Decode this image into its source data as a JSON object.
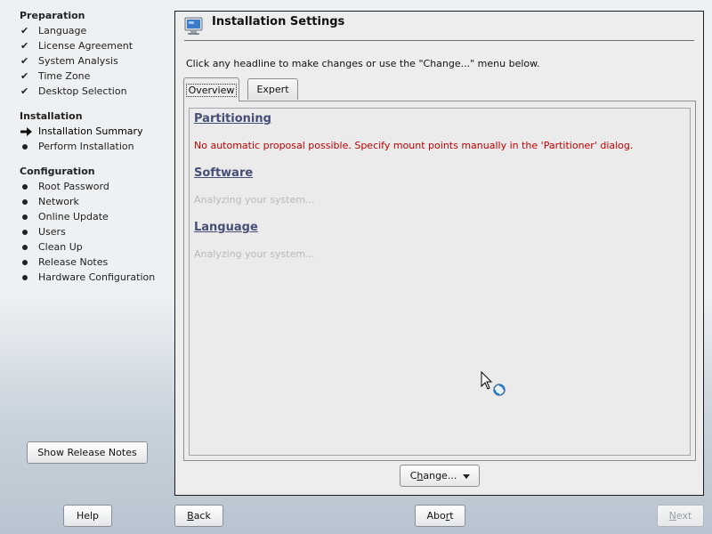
{
  "sidebar": {
    "groups": [
      {
        "heading": "Preparation",
        "items": [
          {
            "label": "Language",
            "state": "done"
          },
          {
            "label": "License Agreement",
            "state": "done"
          },
          {
            "label": "System Analysis",
            "state": "done"
          },
          {
            "label": "Time Zone",
            "state": "done"
          },
          {
            "label": "Desktop Selection",
            "state": "done"
          }
        ]
      },
      {
        "heading": "Installation",
        "items": [
          {
            "label": "Installation Summary",
            "state": "current"
          },
          {
            "label": "Perform Installation",
            "state": "todo"
          }
        ]
      },
      {
        "heading": "Configuration",
        "items": [
          {
            "label": "Root Password",
            "state": "todo"
          },
          {
            "label": "Network",
            "state": "todo"
          },
          {
            "label": "Online Update",
            "state": "todo"
          },
          {
            "label": "Users",
            "state": "todo"
          },
          {
            "label": "Clean Up",
            "state": "todo"
          },
          {
            "label": "Release Notes",
            "state": "todo"
          },
          {
            "label": "Hardware Configuration",
            "state": "todo"
          }
        ]
      }
    ],
    "release_notes_button": "Show Release Notes"
  },
  "main": {
    "title": "Installation Settings",
    "title_icon": "monitor-settings-icon",
    "instruction": "Click any headline to make changes or use the \"Change...\" menu below.",
    "tabs": [
      {
        "label": "Overview",
        "active": true
      },
      {
        "label": "Expert",
        "active": false
      }
    ],
    "sections": [
      {
        "heading": "Partitioning",
        "text": "No automatic proposal possible. Specify mount points manually in the 'Partitioner' dialog.",
        "kind": "error"
      },
      {
        "heading": "Software",
        "text": "Analyzing your system...",
        "kind": "muted"
      },
      {
        "heading": "Language",
        "text": "Analyzing your system...",
        "kind": "muted"
      }
    ],
    "change_button": {
      "pre": "C",
      "underline": "h",
      "post": "ange..."
    }
  },
  "footer": {
    "help": "Help",
    "back": {
      "underline": "B",
      "post": "ack"
    },
    "abort": {
      "pre": "Abo",
      "underline": "r",
      "post": "t"
    },
    "next": {
      "underline": "N",
      "post": "ext"
    }
  },
  "colors": {
    "link": "#474f77",
    "error": "#c00000",
    "muted": "#b9b9b9"
  }
}
